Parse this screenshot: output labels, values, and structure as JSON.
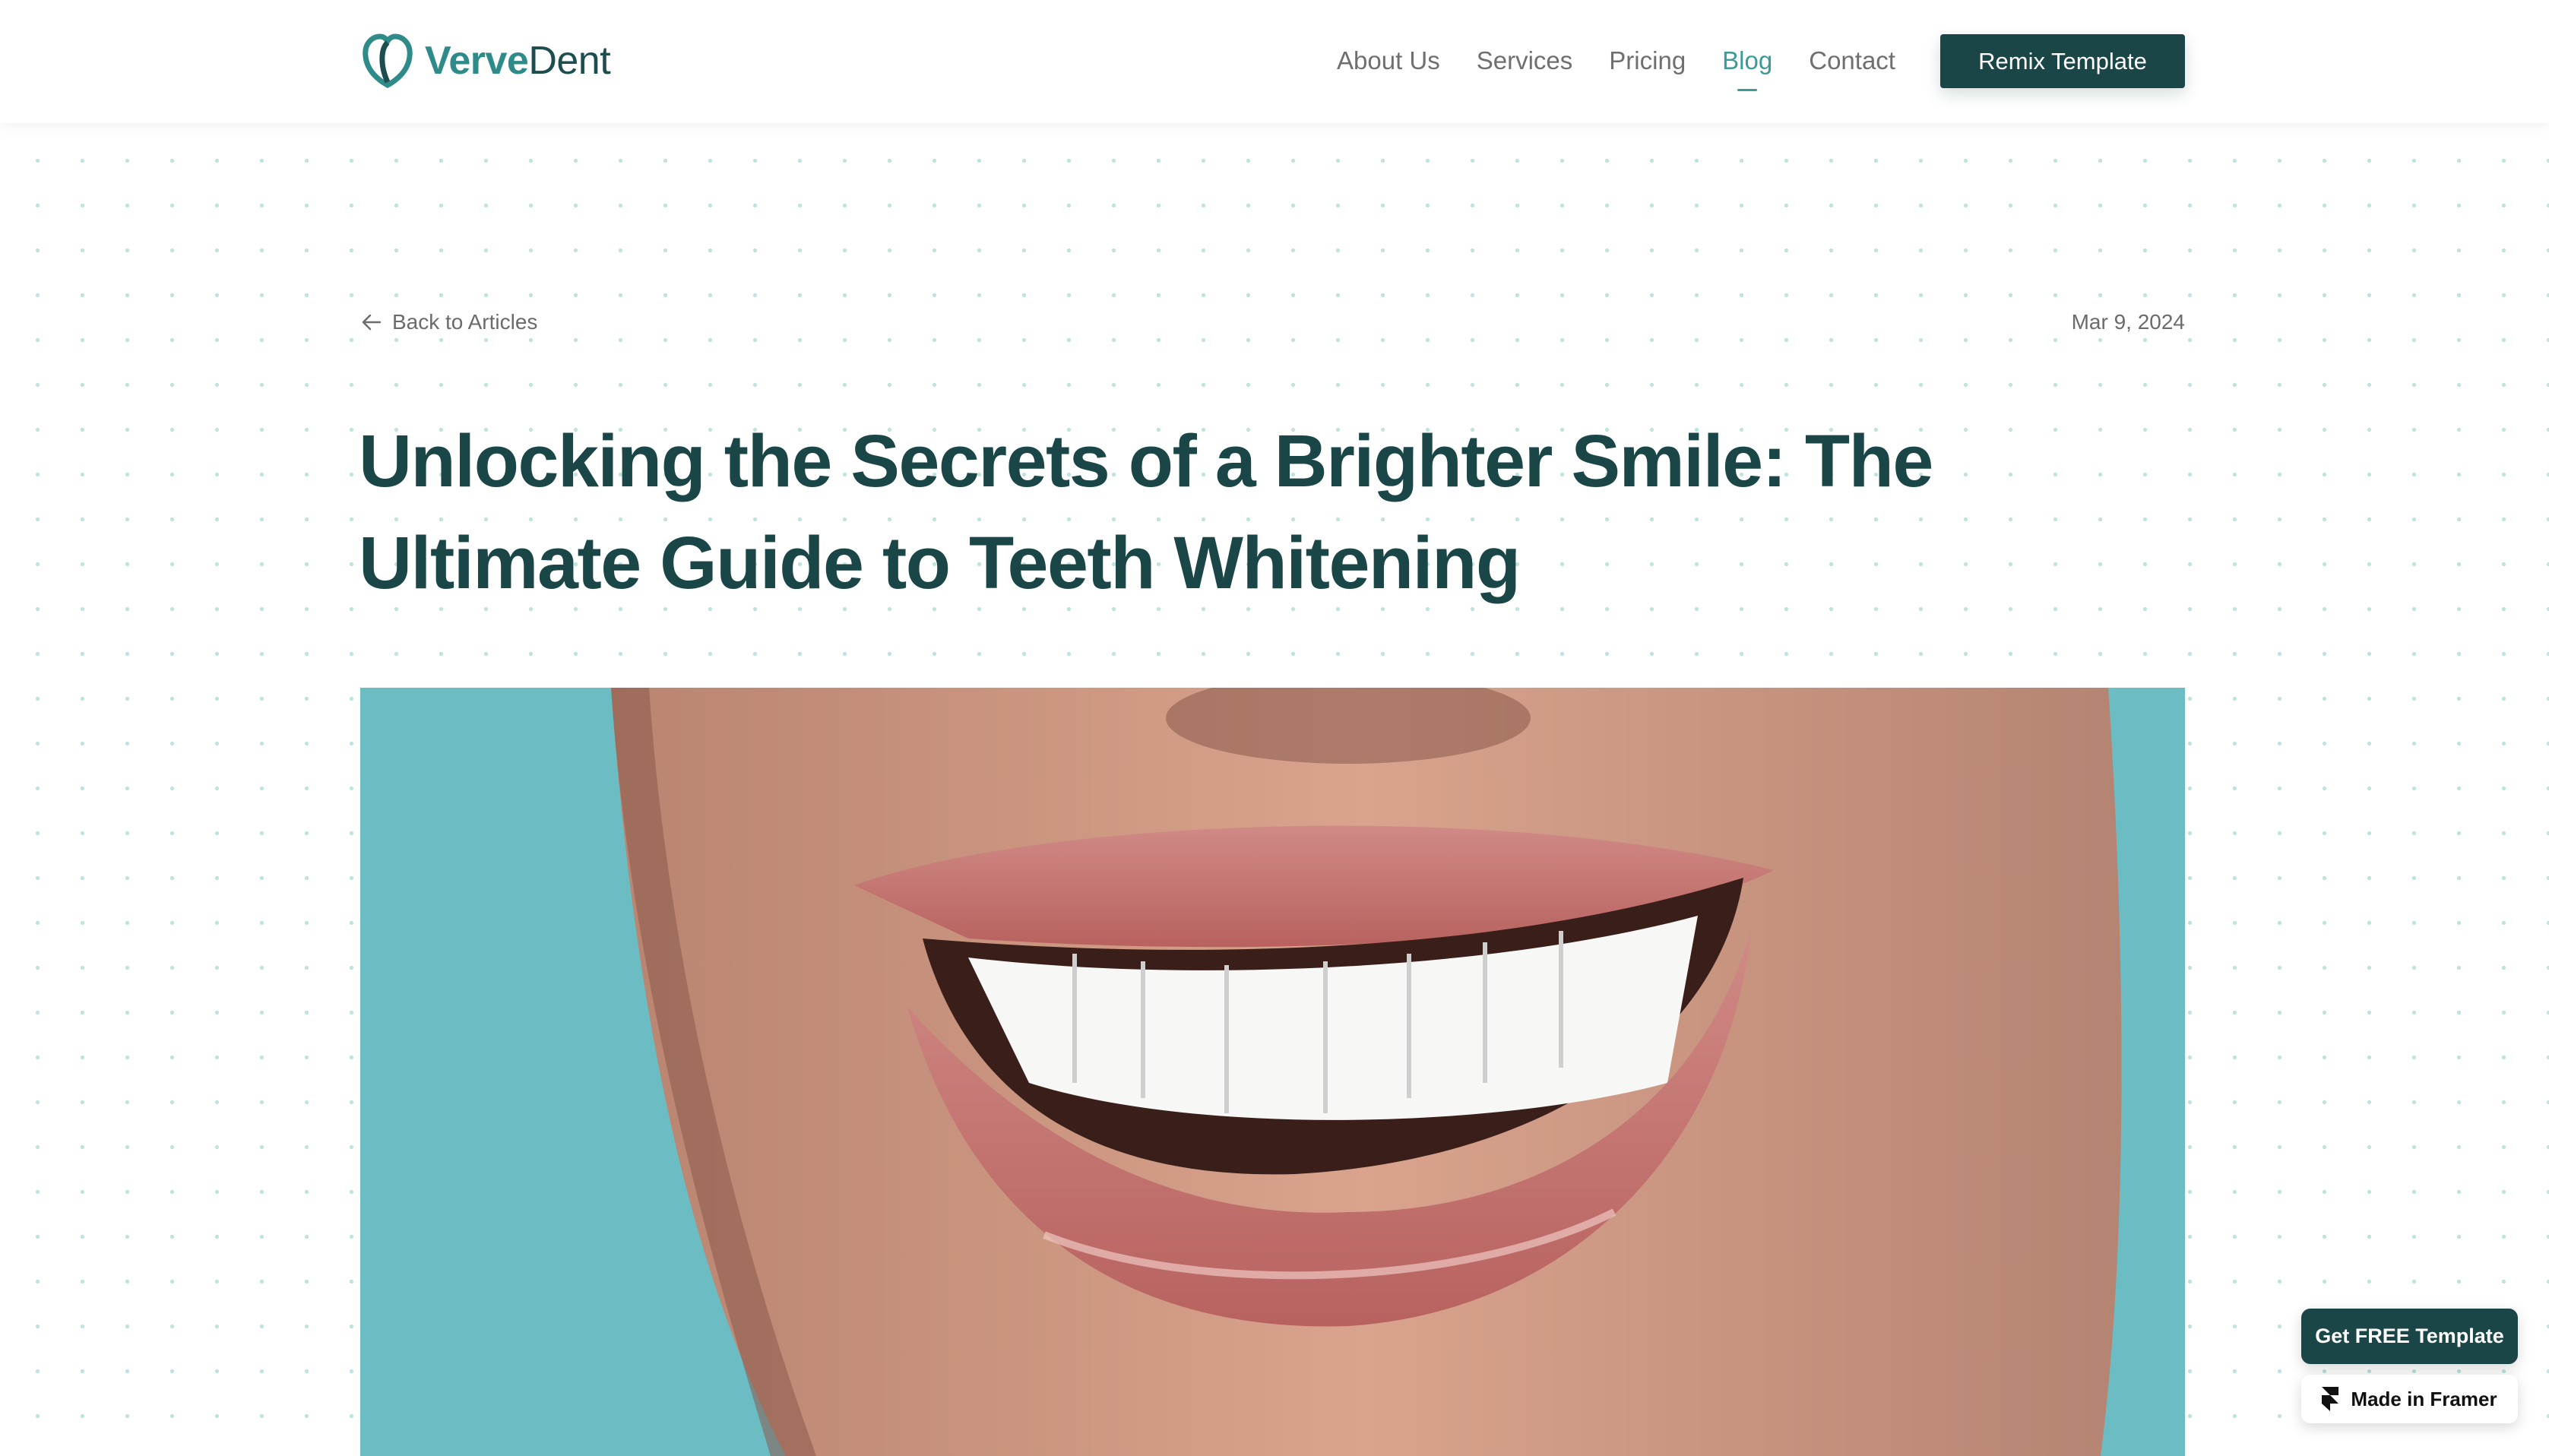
{
  "brand": {
    "name_part1": "Verve",
    "name_part2": "Dent",
    "logo_icon": "tooth-logo-icon"
  },
  "nav": {
    "items": [
      {
        "label": "About Us",
        "active": false
      },
      {
        "label": "Services",
        "active": false
      },
      {
        "label": "Pricing",
        "active": false
      },
      {
        "label": "Blog",
        "active": true
      },
      {
        "label": "Contact",
        "active": false
      }
    ],
    "cta_label": "Remix Template"
  },
  "article": {
    "back_label": "Back to Articles",
    "back_icon": "arrow-left-icon",
    "date": "Mar 9, 2024",
    "title": "Unlocking the Secrets of a Brighter Smile: The Ultimate Guide to Teeth Whitening",
    "hero_image": "smile-with-white-teeth-photo"
  },
  "floating": {
    "get_template_label": "Get FREE Template",
    "made_in_label": "Made in Framer",
    "framer_icon": "framer-logo-icon"
  },
  "colors": {
    "primary_dark": "#1b4648",
    "accent_teal": "#3a9b98",
    "muted_text": "#6f6f6f",
    "dot_pattern": "#bfe3dd"
  }
}
